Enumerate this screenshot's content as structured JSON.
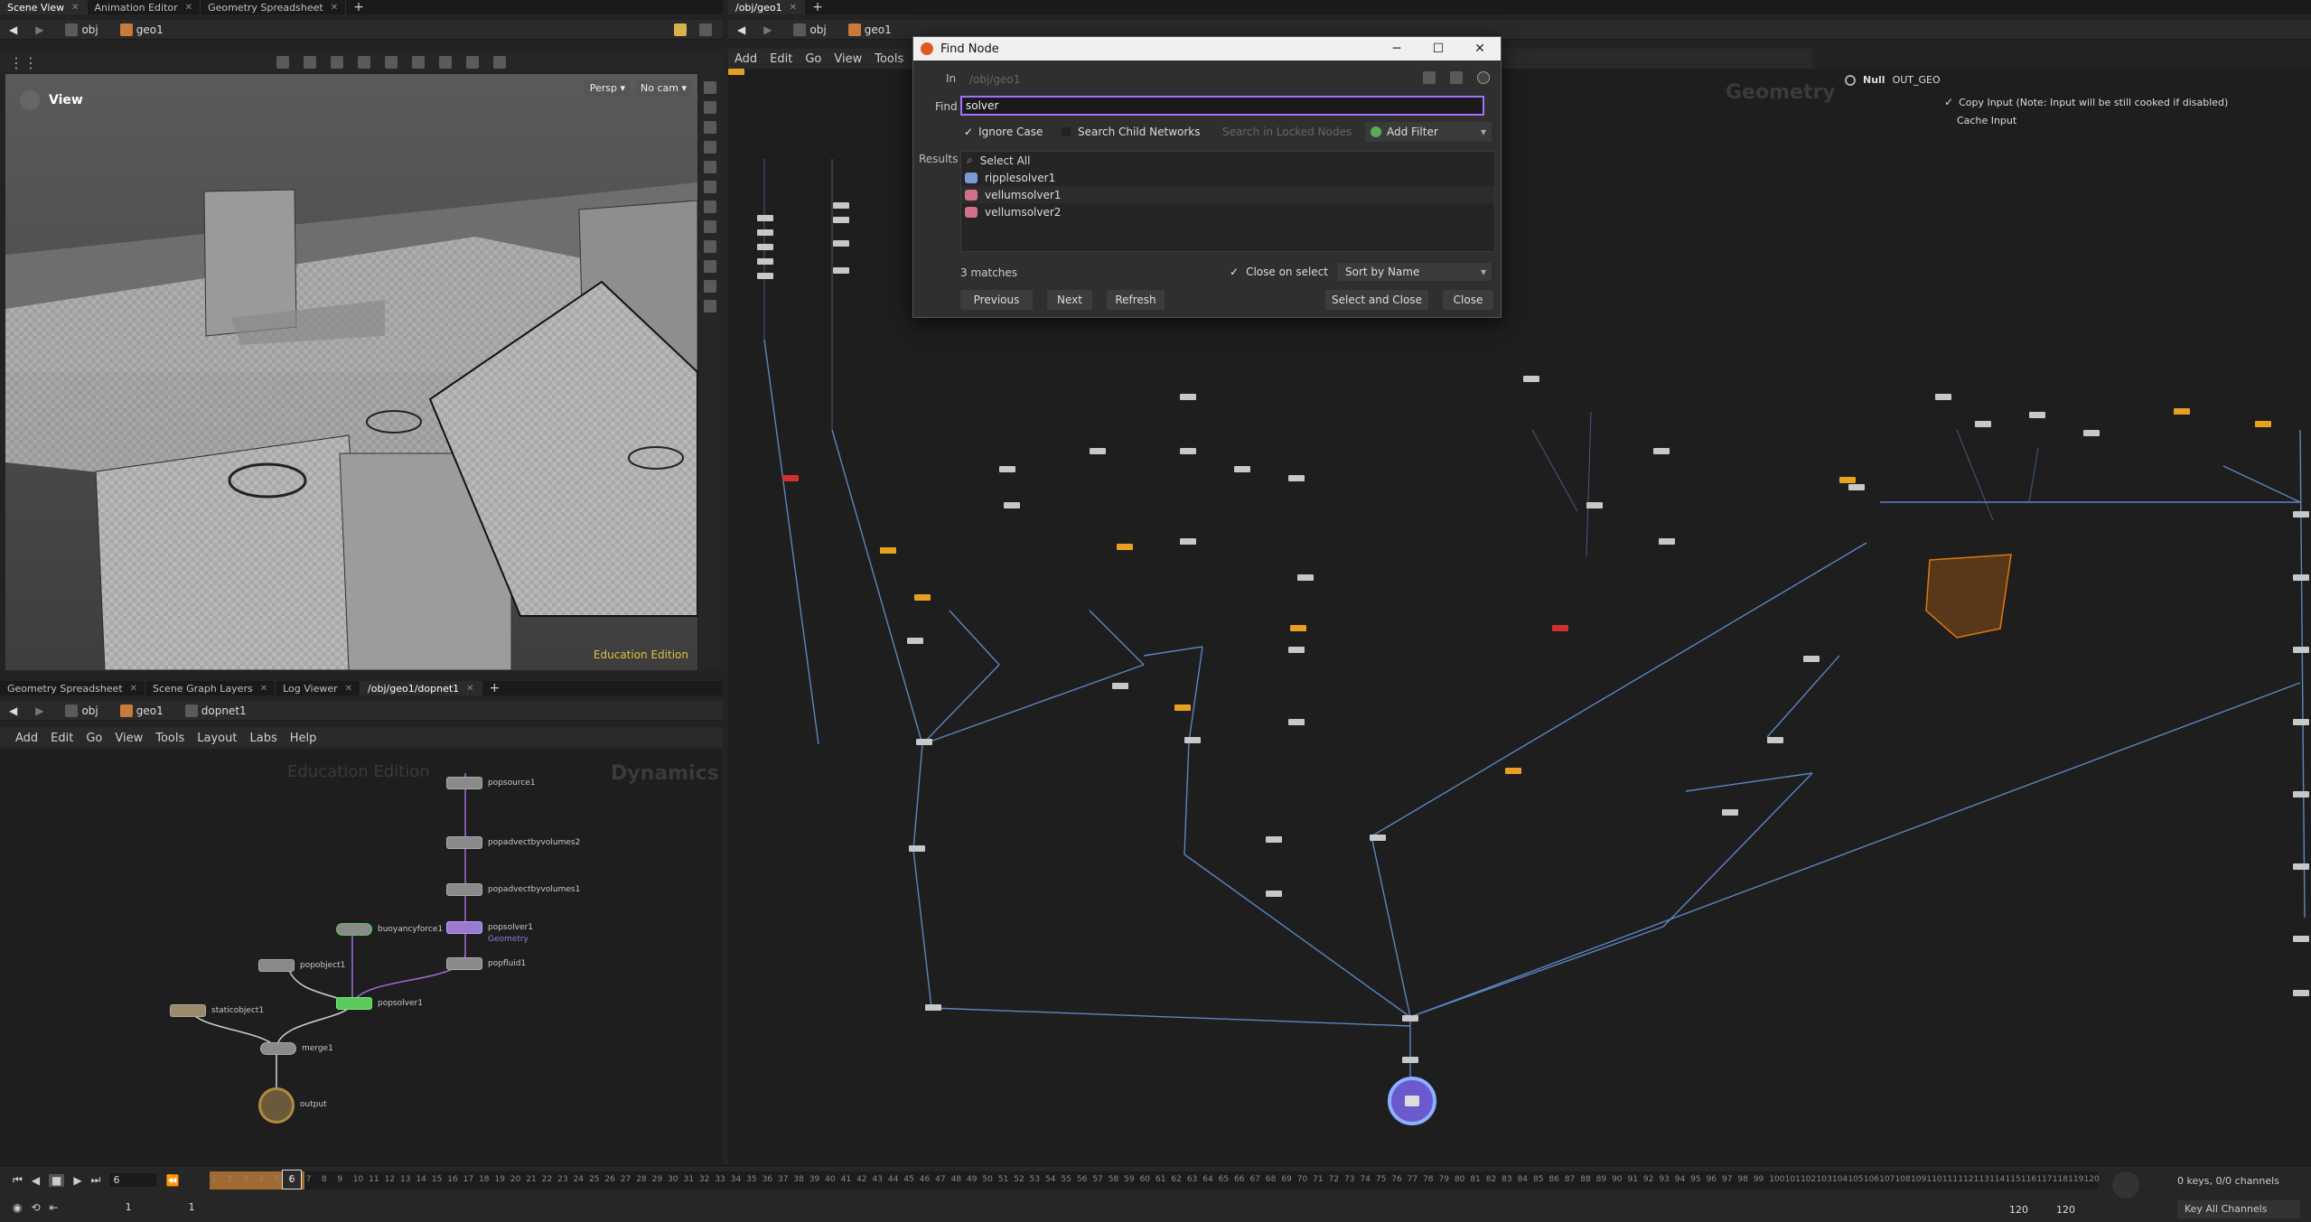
{
  "top_left_tabs": [
    "Scene View",
    "Animation Editor",
    "Geometry Spreadsheet"
  ],
  "top_right_tabs": [
    "/obj/geo1"
  ],
  "path_left": {
    "root": "obj",
    "node": "geo1"
  },
  "path_right": {
    "root": "obj",
    "node": "geo1"
  },
  "viewport": {
    "title": "View",
    "camera_persp": "Persp ▾",
    "camera": "No cam ▾",
    "watermark": "Education Edition"
  },
  "network_menu": [
    "Add",
    "Edit",
    "Go",
    "View",
    "Tools"
  ],
  "network_watermark": "Geometry",
  "parm_panel": {
    "node_type": "Null",
    "node_name": "OUT_GEO",
    "copy_input": "Copy Input (Note: Input will be still cooked if disabled)",
    "cache_input": "Cache Input"
  },
  "bottom_left_tabs": [
    "Geometry Spreadsheet",
    "Scene Graph Layers",
    "Log Viewer",
    "/obj/geo1/dopnet1"
  ],
  "bottom_path": {
    "root": "obj",
    "geo": "geo1",
    "node": "dopnet1"
  },
  "bottom_menu": [
    "Add",
    "Edit",
    "Go",
    "View",
    "Tools",
    "Layout",
    "Labs",
    "Help"
  ],
  "dop_watermark": {
    "edu": "Education Edition",
    "ctx": "Dynamics"
  },
  "dop_nodes": {
    "popsource1": "popsource1",
    "popadvectbyvolumes2": "popadvectbyvolumes2",
    "popadvectbyvolumes1": "popadvectbyvolumes1",
    "buoyancyforce1": "buoyancyforce1",
    "popsolver1a": "popsolver1",
    "popsolver1a_sub": "Geometry",
    "popobject1": "popobject1",
    "popfluid1": "popfluid1",
    "popsolver1b": "popsolver1",
    "staticobject1": "staticobject1",
    "merge1": "merge1",
    "output": "output"
  },
  "find_dialog": {
    "title": "Find Node",
    "in_label": "In",
    "in_value": "/obj/geo1",
    "find_label": "Find",
    "find_value": "solver",
    "ignore_case": "Ignore Case",
    "search_child": "Search Child Networks",
    "search_locked": "Search in Locked Nodes",
    "add_filter": "Add Filter",
    "results_label": "Results",
    "results": [
      "Select All",
      "ripplesolver1",
      "vellumsolver1",
      "vellumsolver2"
    ],
    "matches": "3 matches",
    "close_on_select": "Close on select",
    "sort_by": "Sort by Name",
    "previous": "Previous",
    "next": "Next",
    "refresh": "Refresh",
    "select_and_close": "Select and Close",
    "close": "Close"
  },
  "timeline": {
    "current_frame": "6",
    "frame_marker": "6",
    "start_frame": "1",
    "end_frame": "1",
    "range_end_a": "120",
    "range_end_b": "120",
    "keys_info": "0 keys, 0/0 channels",
    "key_all": "Key All Channels",
    "ticks": [
      "1",
      "2",
      "3",
      "4",
      "5",
      "6",
      "7",
      "8",
      "9",
      "10",
      "11",
      "12",
      "13",
      "14",
      "15",
      "16",
      "17",
      "18",
      "19",
      "20",
      "21",
      "22",
      "23",
      "24",
      "25",
      "26",
      "27",
      "28",
      "29",
      "30",
      "31",
      "32",
      "33",
      "34",
      "35",
      "36",
      "37",
      "38",
      "39",
      "40",
      "41",
      "42",
      "43",
      "44",
      "45",
      "46",
      "47",
      "48",
      "49",
      "50",
      "51",
      "52",
      "53",
      "54",
      "55",
      "56",
      "57",
      "58",
      "59",
      "60",
      "61",
      "62",
      "63",
      "64",
      "65",
      "66",
      "67",
      "68",
      "69",
      "70",
      "71",
      "72",
      "73",
      "74",
      "75",
      "76",
      "77",
      "78",
      "79",
      "80",
      "81",
      "82",
      "83",
      "84",
      "85",
      "86",
      "87",
      "88",
      "89",
      "90",
      "91",
      "92",
      "93",
      "94",
      "95",
      "96",
      "97",
      "98",
      "99",
      "100",
      "101",
      "102",
      "103",
      "104",
      "105",
      "106",
      "107",
      "108",
      "109",
      "110",
      "111",
      "112",
      "113",
      "114",
      "115",
      "116",
      "117",
      "118",
      "119",
      "120"
    ]
  },
  "colors": {
    "accent": "#e8a020",
    "dialog_focus": "#a070ff",
    "selected_node": "#6a5acd"
  }
}
